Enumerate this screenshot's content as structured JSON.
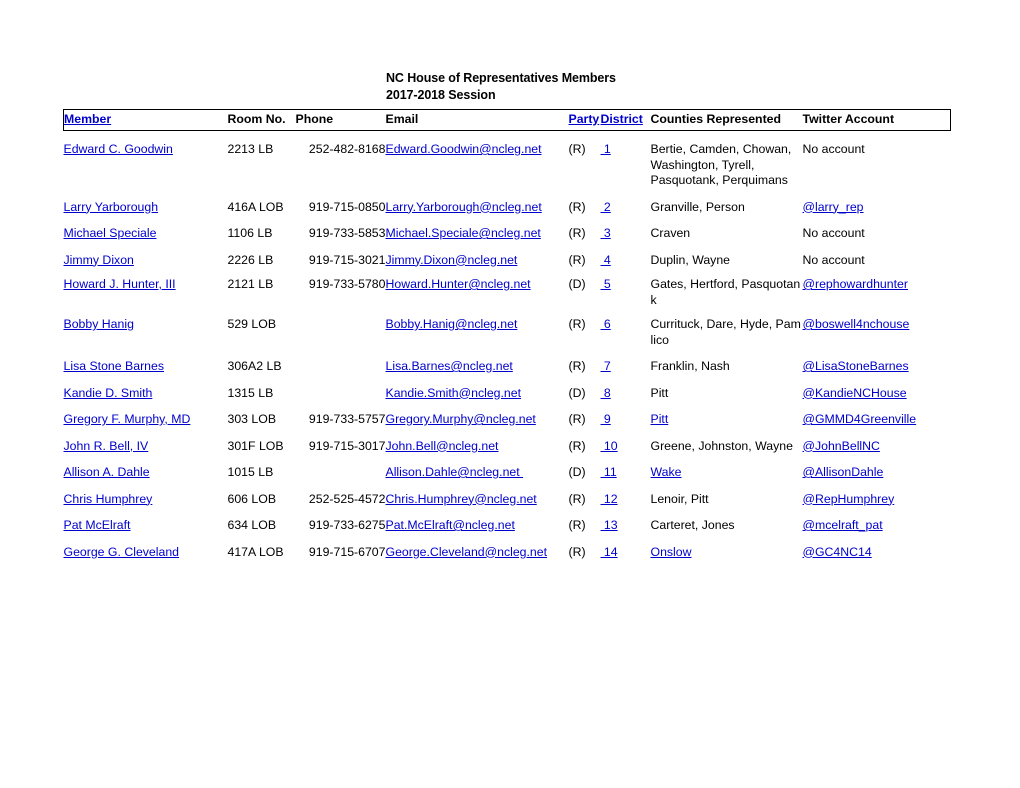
{
  "document": {
    "title_line_1": "NC House of Representatives Members",
    "title_line_2": "2017-2018 Session"
  },
  "colors": {
    "link": "#0000CC",
    "text": "#000000",
    "background": "#FFFFFF"
  },
  "table": {
    "headers": {
      "member": "Member",
      "room": "Room No.",
      "phone": "Phone",
      "email": "Email",
      "party": "Party",
      "district": "District",
      "counties": "Counties Represented",
      "twitter": "Twitter Account"
    },
    "rows": [
      {
        "member": "Edward C. Goodwin",
        "room": "2213 LB",
        "phone": "252-482-8168",
        "email": "Edward.Goodwin@ncleg.net",
        "party": "(R)",
        "district": " 1",
        "counties": "Bertie, Camden, Chowan, Washington, Tyrell, Pasquotank, Perquimans",
        "twitter": "No account"
      },
      {
        "member": "Larry Yarborough",
        "room": "416A LOB",
        "phone": "919-715-0850",
        "email": "Larry.Yarborough@ncleg.net",
        "party": "(R)",
        "district": " 2",
        "counties": "Granville, Person",
        "twitter": "@larry_rep"
      },
      {
        "member": "Michael Speciale",
        "room": "1106 LB",
        "phone": "919-733-5853",
        "email": "Michael.Speciale@ncleg.net",
        "party": "(R)",
        "district": " 3",
        "counties": "Craven",
        "twitter": "No account"
      },
      {
        "member": "Jimmy Dixon",
        "room": "2226 LB",
        "phone": "919-715-3021",
        "email": "Jimmy.Dixon@ncleg.net",
        "party": "(R)",
        "district": " 4",
        "counties": "Duplin, Wayne",
        "twitter": "No account"
      },
      {
        "member": "Howard J. Hunter, III",
        "room": "2121 LB",
        "phone": "919-733-5780",
        "email": "Howard.Hunter@ncleg.net",
        "party": "(D)",
        "district": " 5",
        "counties": "Gates, Hertford, Pasquotank",
        "twitter": "@rephowardhunter"
      },
      {
        "member": "Bobby Hanig",
        "room": "529 LOB",
        "phone": "",
        "email": "Bobby.Hanig@ncleg.net",
        "party": "(R)",
        "district": " 6",
        "counties": "Currituck, Dare, Hyde, Pamlico",
        "twitter": "@boswell4nchouse"
      },
      {
        "member": "Lisa Stone Barnes",
        "room": "306A2 LB",
        "phone": "",
        "email": "Lisa.Barnes@ncleg.net",
        "party": "(R)",
        "district": " 7",
        "counties": "Franklin, Nash",
        "twitter": "@LisaStoneBarnes"
      },
      {
        "member": "Kandie D. Smith",
        "room": "1315 LB",
        "phone": "",
        "email": "Kandie.Smith@ncleg.net",
        "party": "(D)",
        "district": " 8",
        "counties": "Pitt",
        "twitter": "@KandieNCHouse"
      },
      {
        "member": "Gregory F. Murphy, MD",
        "room": "303 LOB",
        "phone": "919-733-5757",
        "email": "Gregory.Murphy@ncleg.net",
        "party": "(R)",
        "district": " 9",
        "counties": "Pitt",
        "twitter": "@GMMD4Greenville"
      },
      {
        "member": "John R. Bell, IV",
        "room": "301F LOB",
        "phone": "919-715-3017",
        "email": "John.Bell@ncleg.net",
        "party": "(R)",
        "district": " 10",
        "counties": "Greene, Johnston, Wayne",
        "twitter": "@JohnBellNC"
      },
      {
        "member": "Allison A. Dahle",
        "room": "1015 LB",
        "phone": "",
        "email": "Allison.Dahle@ncleg.net ",
        "party": "(D)",
        "district": " 11",
        "counties": "Wake",
        "twitter": "@AllisonDahle"
      },
      {
        "member": "Chris Humphrey",
        "room": "606 LOB",
        "phone": "252-525-4572",
        "email": "Chris.Humphrey@ncleg.net",
        "party": "(R)",
        "district": " 12",
        "counties": "Lenoir, Pitt",
        "twitter": "@RepHumphrey"
      },
      {
        "member": "Pat McElraft",
        "room": "634 LOB",
        "phone": "919-733-6275",
        "email": "Pat.McElraft@ncleg.net",
        "party": "(R)",
        "district": " 13",
        "counties": "Carteret, Jones",
        "twitter": "@mcelraft_pat"
      },
      {
        "member": "George G. Cleveland",
        "room": "417A LOB",
        "phone": "919-715-6707",
        "email": "George.Cleveland@ncleg.net",
        "party": "(R)",
        "district": " 14",
        "counties": "Onslow",
        "twitter": "@GC4NC14"
      }
    ],
    "link_flags": {
      "member_is_link": [
        true,
        true,
        true,
        true,
        true,
        true,
        true,
        true,
        true,
        true,
        true,
        true,
        true,
        true
      ],
      "email_is_link": [
        true,
        true,
        true,
        true,
        true,
        true,
        true,
        true,
        true,
        true,
        true,
        true,
        true,
        true
      ],
      "district_is_link": [
        true,
        true,
        true,
        true,
        true,
        true,
        true,
        true,
        true,
        true,
        true,
        true,
        true,
        true
      ],
      "counties_is_link": [
        false,
        false,
        false,
        false,
        false,
        false,
        false,
        false,
        true,
        false,
        true,
        false,
        false,
        true
      ],
      "twitter_is_link": [
        false,
        true,
        false,
        false,
        true,
        true,
        true,
        true,
        true,
        true,
        true,
        true,
        true,
        true
      ],
      "counties_breaks": [
        false,
        false,
        false,
        false,
        true,
        true,
        false,
        false,
        false,
        false,
        false,
        false,
        false,
        false
      ]
    }
  }
}
